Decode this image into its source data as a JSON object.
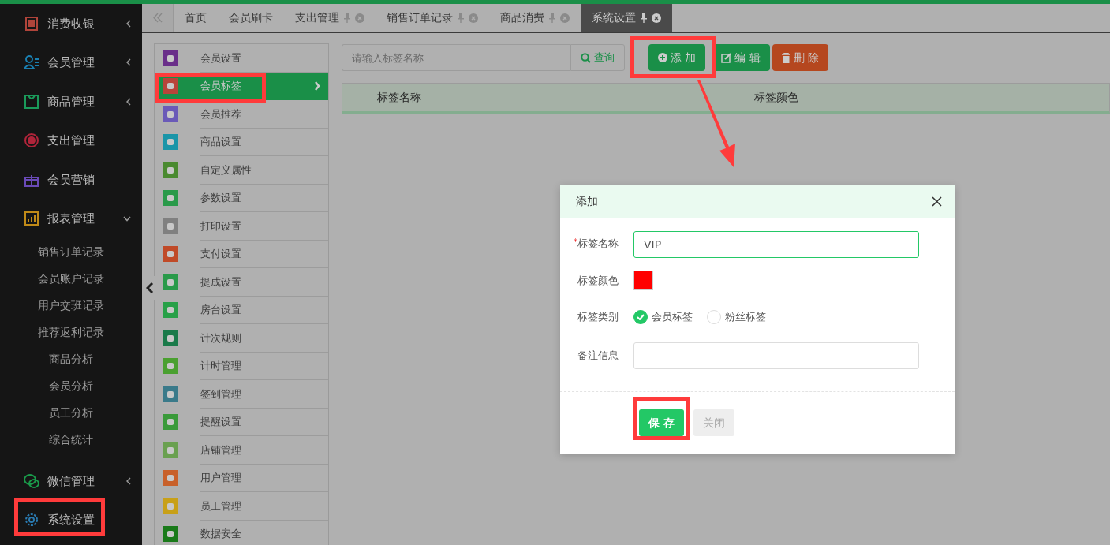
{
  "sidebar": {
    "items": [
      {
        "label": "消费收银",
        "kind": "group",
        "expanded": false
      },
      {
        "label": "会员管理",
        "kind": "group",
        "expanded": false
      },
      {
        "label": "商品管理",
        "kind": "group",
        "expanded": false
      },
      {
        "label": "支出管理",
        "kind": "link"
      },
      {
        "label": "会员营销",
        "kind": "link"
      },
      {
        "label": "报表管理",
        "kind": "group",
        "expanded": true,
        "children": [
          {
            "label": "销售订单记录"
          },
          {
            "label": "会员账户记录"
          },
          {
            "label": "用户交班记录"
          },
          {
            "label": "推荐返利记录"
          },
          {
            "label": "商品分析"
          },
          {
            "label": "会员分析"
          },
          {
            "label": "员工分析"
          },
          {
            "label": "综合统计"
          }
        ]
      },
      {
        "label": "微信管理",
        "kind": "group",
        "expanded": false
      },
      {
        "label": "系统设置",
        "kind": "link"
      }
    ]
  },
  "tabs": [
    {
      "label": "首页",
      "closable": false,
      "selected": false
    },
    {
      "label": "会员刷卡",
      "closable": false,
      "selected": false
    },
    {
      "label": "支出管理",
      "closable": true,
      "selected": false
    },
    {
      "label": "销售订单记录",
      "closable": true,
      "selected": false
    },
    {
      "label": "商品消费",
      "closable": true,
      "selected": false
    },
    {
      "label": "系统设置",
      "closable": true,
      "selected": true
    }
  ],
  "settings_menu": [
    {
      "label": "会员设置",
      "color": "#6a2f8a",
      "selected": false
    },
    {
      "label": "会员标签",
      "color": "#b8443a",
      "selected": true
    },
    {
      "label": "会员推荐",
      "color": "#6a5ab8",
      "selected": false
    },
    {
      "label": "商品设置",
      "color": "#1a95a8",
      "selected": false
    },
    {
      "label": "自定义属性",
      "color": "#4a8a30",
      "selected": false
    },
    {
      "label": "参数设置",
      "color": "#2a9a4a",
      "selected": false
    },
    {
      "label": "打印设置",
      "color": "#808080",
      "selected": false
    },
    {
      "label": "支付设置",
      "color": "#c04a28",
      "selected": false
    },
    {
      "label": "提成设置",
      "color": "#2a9a4a",
      "selected": false
    },
    {
      "label": "房台设置",
      "color": "#28a048",
      "selected": false
    },
    {
      "label": "计次规则",
      "color": "#1a7a4a",
      "selected": false
    },
    {
      "label": "计时管理",
      "color": "#4aa030",
      "selected": false
    },
    {
      "label": "签到管理",
      "color": "#3a7a8a",
      "selected": false
    },
    {
      "label": "提醒设置",
      "color": "#3a9a3a",
      "selected": false
    },
    {
      "label": "店铺管理",
      "color": "#6aa050",
      "selected": false
    },
    {
      "label": "用户管理",
      "color": "#c8602a",
      "selected": false
    },
    {
      "label": "员工管理",
      "color": "#c8a018",
      "selected": false
    },
    {
      "label": "数据安全",
      "color": "#1a7a1a",
      "selected": false
    }
  ],
  "search": {
    "placeholder": "请输入标签名称",
    "button": "查询"
  },
  "toolbar": [
    {
      "label": "添 加",
      "kind": "add"
    },
    {
      "label": "编 辑",
      "kind": "edit"
    },
    {
      "label": "删 除",
      "kind": "delete"
    }
  ],
  "table": {
    "columns": [
      "标签名称",
      "标签颜色"
    ]
  },
  "dialog": {
    "title": "添加",
    "name": {
      "marker": "*",
      "label": "标签名称",
      "value": "VIP"
    },
    "color": {
      "label": "标签颜色",
      "color": "#ff0000"
    },
    "category": {
      "label": "标签类别",
      "options": [
        {
          "label": "会员标签",
          "selected": true
        },
        {
          "label": "粉丝标签",
          "selected": false
        }
      ]
    },
    "note": {
      "label": "备注信息"
    },
    "buttons": [
      {
        "label": "保 存",
        "kind": "primary"
      },
      {
        "label": "关闭",
        "kind": "secondary"
      }
    ]
  }
}
